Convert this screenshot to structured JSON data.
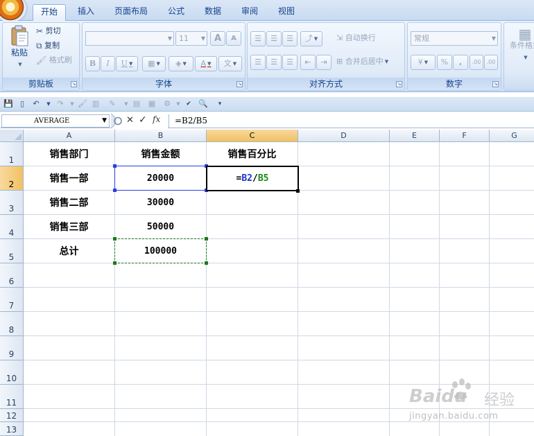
{
  "tabs": [
    {
      "label": "开始",
      "active": true
    },
    {
      "label": "插入",
      "active": false
    },
    {
      "label": "页面布局",
      "active": false
    },
    {
      "label": "公式",
      "active": false
    },
    {
      "label": "数据",
      "active": false
    },
    {
      "label": "审阅",
      "active": false
    },
    {
      "label": "视图",
      "active": false
    }
  ],
  "ribbon": {
    "clipboard": {
      "paste": "粘贴",
      "cut": "剪切",
      "copy": "复制",
      "format_painter": "格式刷",
      "label": "剪贴板"
    },
    "font": {
      "font_name": "",
      "font_size": "11",
      "bold": "B",
      "italic": "I",
      "underline": "U",
      "grow": "A",
      "shrink": "A",
      "font_color": "A",
      "phonetic": "文",
      "label": "字体"
    },
    "alignment": {
      "wrap_text": "自动换行",
      "merge_center": "合并后居中",
      "label": "对齐方式"
    },
    "number": {
      "format": "常规",
      "percent": "%",
      "comma": ",",
      "inc_decimal": ".00",
      "dec_decimal": ".00",
      "label": "数字"
    },
    "styles": {
      "conditional_format": "条件格式"
    }
  },
  "formula_bar": {
    "name_box": "AVERAGE",
    "fx_label": "fx",
    "formula": "=B2/B5"
  },
  "columns": [
    "A",
    "B",
    "C",
    "D",
    "E",
    "F",
    "G"
  ],
  "rows": [
    "1",
    "2",
    "3",
    "4",
    "5",
    "6",
    "7",
    "8",
    "9",
    "10",
    "11",
    "12",
    "13"
  ],
  "cells": {
    "A1": "销售部门",
    "B1": "销售金额",
    "C1": "销售百分比",
    "A2": "销售一部",
    "B2": "20000",
    "A3": "销售二部",
    "B3": "30000",
    "A4": "销售三部",
    "B4": "50000",
    "A5": "总计",
    "B5": "100000"
  },
  "editing_cell": {
    "eq": "=",
    "ref1": "B2",
    "op": "/",
    "ref2": "B5"
  },
  "active_cell": "C2",
  "watermark": {
    "brand": "Baidu",
    "brand_cn": "经验",
    "url": "jingyan.baidu.com"
  },
  "colors": {
    "ref_blue": "#1a31d6",
    "ref_green": "#128a12",
    "header_selected": "#f1c15f",
    "ribbon_text": "#15428b"
  }
}
